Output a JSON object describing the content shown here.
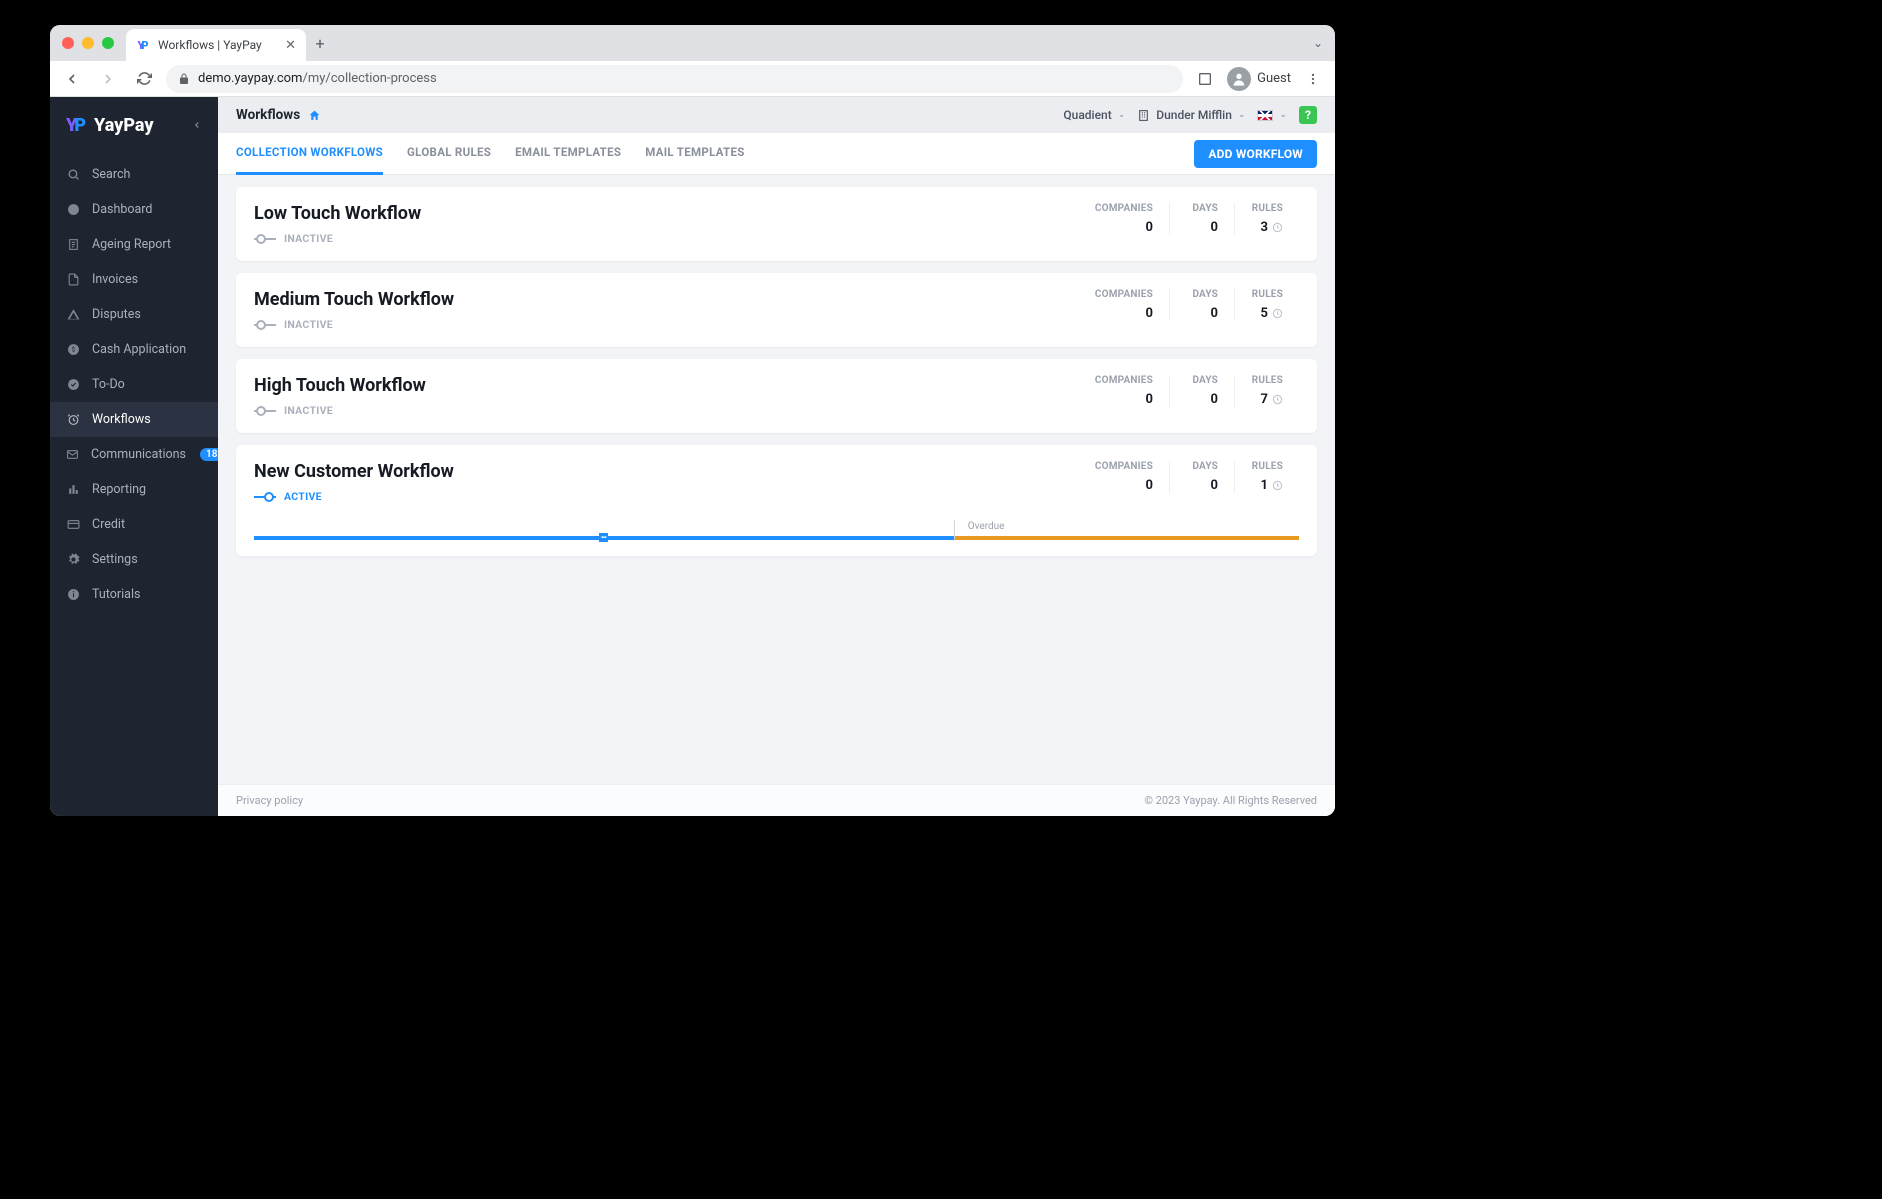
{
  "browser": {
    "tab_title": "Workflows | YayPay",
    "url_domain": "demo.yaypay.com",
    "url_path": "/my/collection-process",
    "guest_label": "Guest"
  },
  "brand": {
    "name": "YayPay"
  },
  "sidebar": {
    "items": [
      {
        "label": "Search",
        "icon": "search"
      },
      {
        "label": "Dashboard",
        "icon": "dashboard"
      },
      {
        "label": "Ageing Report",
        "icon": "report"
      },
      {
        "label": "Invoices",
        "icon": "invoice"
      },
      {
        "label": "Disputes",
        "icon": "warning"
      },
      {
        "label": "Cash Application",
        "icon": "dollar"
      },
      {
        "label": "To-Do",
        "icon": "check"
      },
      {
        "label": "Workflows",
        "icon": "alarm"
      },
      {
        "label": "Communications",
        "icon": "mail",
        "badge": "18"
      },
      {
        "label": "Reporting",
        "icon": "bar"
      },
      {
        "label": "Credit",
        "icon": "card"
      },
      {
        "label": "Settings",
        "icon": "gear"
      },
      {
        "label": "Tutorials",
        "icon": "info"
      }
    ]
  },
  "topbar": {
    "title": "Workflows",
    "parent_org": "Quadient",
    "company": "Dunder Mifflin"
  },
  "tabs": [
    "COLLECTION WORKFLOWS",
    "GLOBAL RULES",
    "EMAIL TEMPLATES",
    "MAIL TEMPLATES"
  ],
  "add_button": "ADD WORKFLOW",
  "stat_labels": {
    "companies": "COMPANIES",
    "days": "DAYS",
    "rules": "RULES"
  },
  "status_labels": {
    "active": "ACTIVE",
    "inactive": "INACTIVE"
  },
  "overdue_label": "Overdue",
  "workflows": [
    {
      "name": "Low Touch Workflow",
      "status": "inactive",
      "companies": "0",
      "days": "0",
      "rules": "3"
    },
    {
      "name": "Medium Touch Workflow",
      "status": "inactive",
      "companies": "0",
      "days": "0",
      "rules": "5"
    },
    {
      "name": "High Touch Workflow",
      "status": "inactive",
      "companies": "0",
      "days": "0",
      "rules": "7"
    },
    {
      "name": "New Customer Workflow",
      "status": "active",
      "companies": "0",
      "days": "0",
      "rules": "1"
    }
  ],
  "footer": {
    "privacy": "Privacy policy",
    "copyright": "© 2023 Yaypay. All Rights Reserved"
  }
}
